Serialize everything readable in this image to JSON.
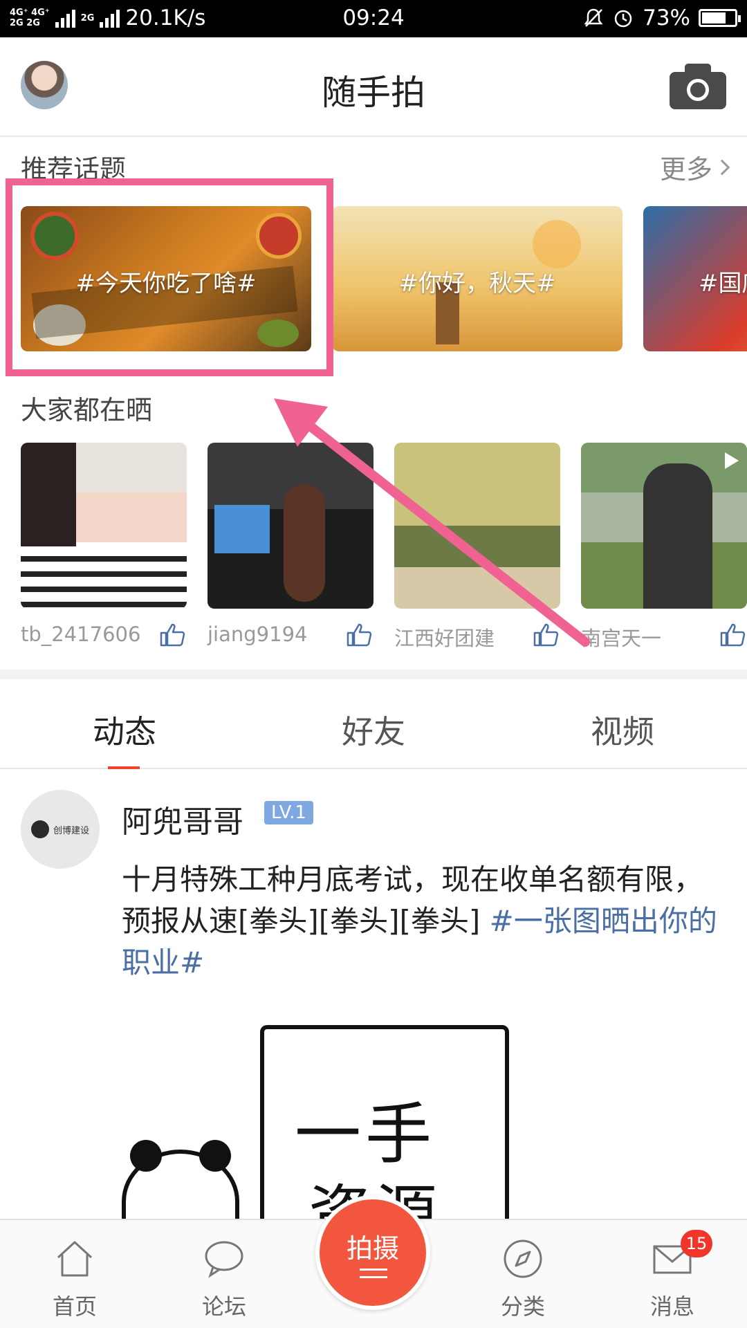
{
  "status_bar": {
    "network_top": "4G⁺ 4G⁺",
    "network_bottom": "2G 2G",
    "extra_net": "2G",
    "speed": "20.1K/s",
    "time": "09:24",
    "battery": "73%",
    "battery_level": 0.73
  },
  "header": {
    "title": "随手拍"
  },
  "topics": {
    "section_title": "推荐话题",
    "more_label": "更多",
    "items": [
      {
        "label": "#今天你吃了啥#"
      },
      {
        "label": "#你好，秋天#"
      },
      {
        "label": "#国庆"
      }
    ]
  },
  "shares": {
    "section_title": "大家都在晒",
    "items": [
      {
        "user": "tb_2417606"
      },
      {
        "user": "jiang9194"
      },
      {
        "user": "江西好团建"
      },
      {
        "user": "南宫天一"
      }
    ]
  },
  "tabs": [
    {
      "label": "动态",
      "active": true
    },
    {
      "label": "好友",
      "active": false
    },
    {
      "label": "视频",
      "active": false
    }
  ],
  "post": {
    "author": "阿兜哥哥",
    "level": "LV.1",
    "avatar_text": "创博建设",
    "text": "十月特殊工种月底考试，现在收单名额有限，预报从速[拳头][拳头][拳头] ",
    "hashtag": "#一张图晒出你的职业#",
    "meme_line1": "一手",
    "meme_line2": "资源"
  },
  "bottom_nav": {
    "home": "首页",
    "forum": "论坛",
    "shoot": "拍摄",
    "category": "分类",
    "messages": "消息",
    "message_count": "15"
  },
  "colors": {
    "accent": "#f0432f",
    "highlight": "#f06292",
    "hashtag": "#4a6fa5",
    "level_badge": "#7fa7e0"
  }
}
